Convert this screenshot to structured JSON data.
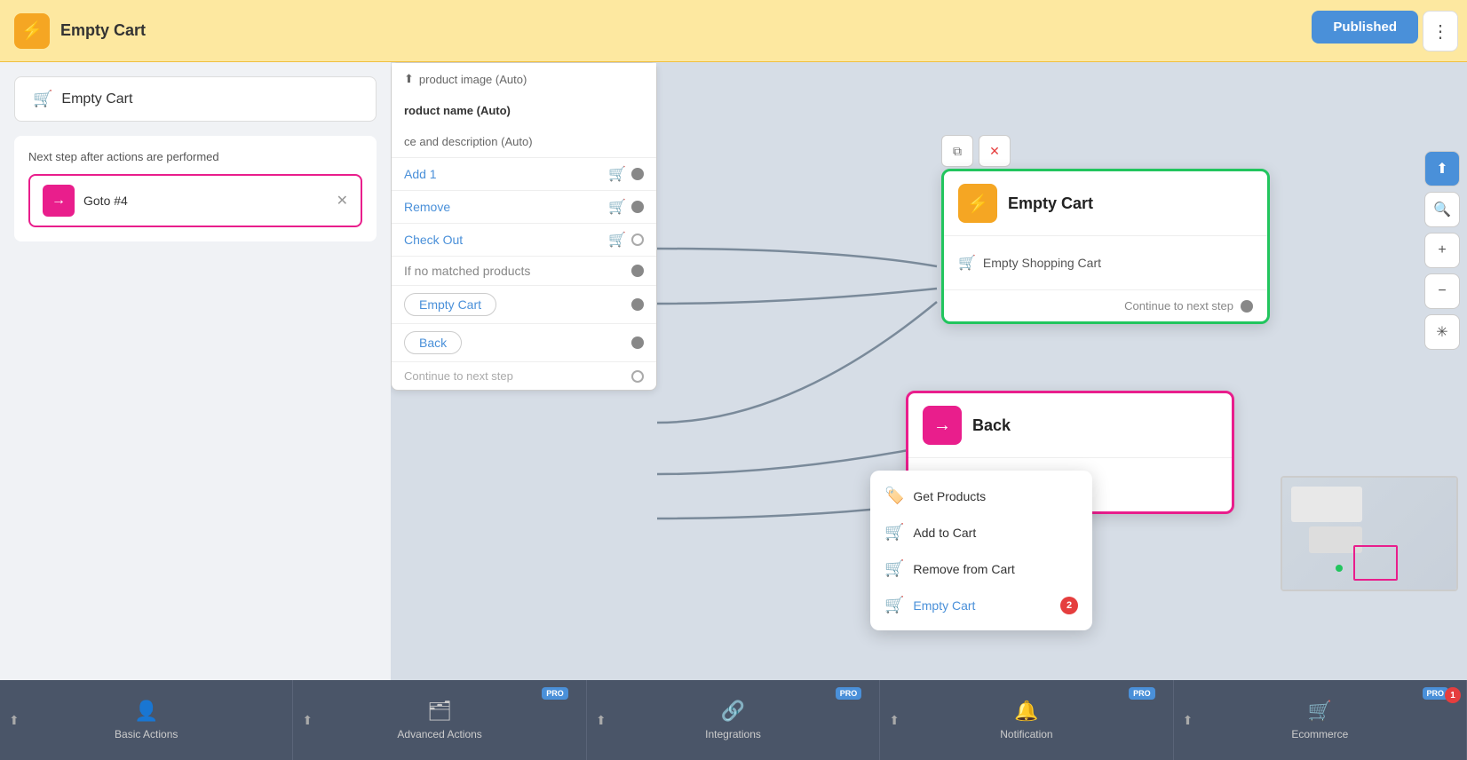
{
  "topbar": {
    "title": "Empty Cart",
    "menu_icon": "≡"
  },
  "published_btn": "Published",
  "left_panel": {
    "trigger_label": "Empty Cart",
    "next_step_label": "Next step after actions are performed",
    "goto_label": "Goto #4"
  },
  "canvas": {
    "product_node": {
      "header1": "product image (Auto)",
      "header2": "roduct name (Auto)",
      "header3": "ce and description (Auto)",
      "items": [
        {
          "label": "Add 1",
          "icon": "🛒",
          "has_dot": true
        },
        {
          "label": "Remove",
          "icon": "🛒",
          "has_dot": true
        },
        {
          "label": "Check Out",
          "icon": "🛒",
          "has_dot": false
        },
        {
          "label": "If no matched products",
          "has_dot": true
        },
        {
          "label": "Empty Cart",
          "has_dot": true
        },
        {
          "label": "Back",
          "has_dot": true
        },
        {
          "label": "Continue to next step",
          "has_dot": false
        }
      ]
    },
    "empty_cart_node": {
      "title": "Empty Cart",
      "action": "Empty Shopping Cart",
      "footer": "Continue to next step"
    },
    "back_node": {
      "title": "Back"
    },
    "context_menu": {
      "items": [
        {
          "label": "Get Products",
          "icon": "🏷️",
          "badge": null,
          "highlight": false
        },
        {
          "label": "Add to Cart",
          "icon": "🛒",
          "badge": null,
          "highlight": false
        },
        {
          "label": "Remove from Cart",
          "icon": "🛒",
          "badge": null,
          "highlight": false
        },
        {
          "label": "Empty Cart",
          "icon": "🛒",
          "badge": "2",
          "highlight": true
        }
      ]
    }
  },
  "right_toolbar": {
    "buttons": [
      "⬆",
      "🔍",
      "+",
      "−",
      "✳"
    ]
  },
  "bottom_bar": {
    "tabs": [
      {
        "icon": "⬆",
        "label": "Basic Actions",
        "pro": false,
        "has_arrow": true,
        "count": null
      },
      {
        "icon": "🗂",
        "label": "Advanced Actions",
        "pro": true,
        "has_arrow": true,
        "count": null
      },
      {
        "icon": "🔗",
        "label": "Integrations",
        "pro": true,
        "has_arrow": true,
        "count": null
      },
      {
        "icon": "🔔",
        "label": "Notification",
        "pro": true,
        "has_arrow": true,
        "count": null
      },
      {
        "icon": "🛒",
        "label": "Ecommerce",
        "pro": true,
        "has_arrow": true,
        "count": "1"
      }
    ]
  },
  "colors": {
    "orange": "#f5a623",
    "pink": "#e91e8c",
    "green": "#22c55e",
    "blue": "#4a90d9",
    "red": "#e53e3e"
  }
}
